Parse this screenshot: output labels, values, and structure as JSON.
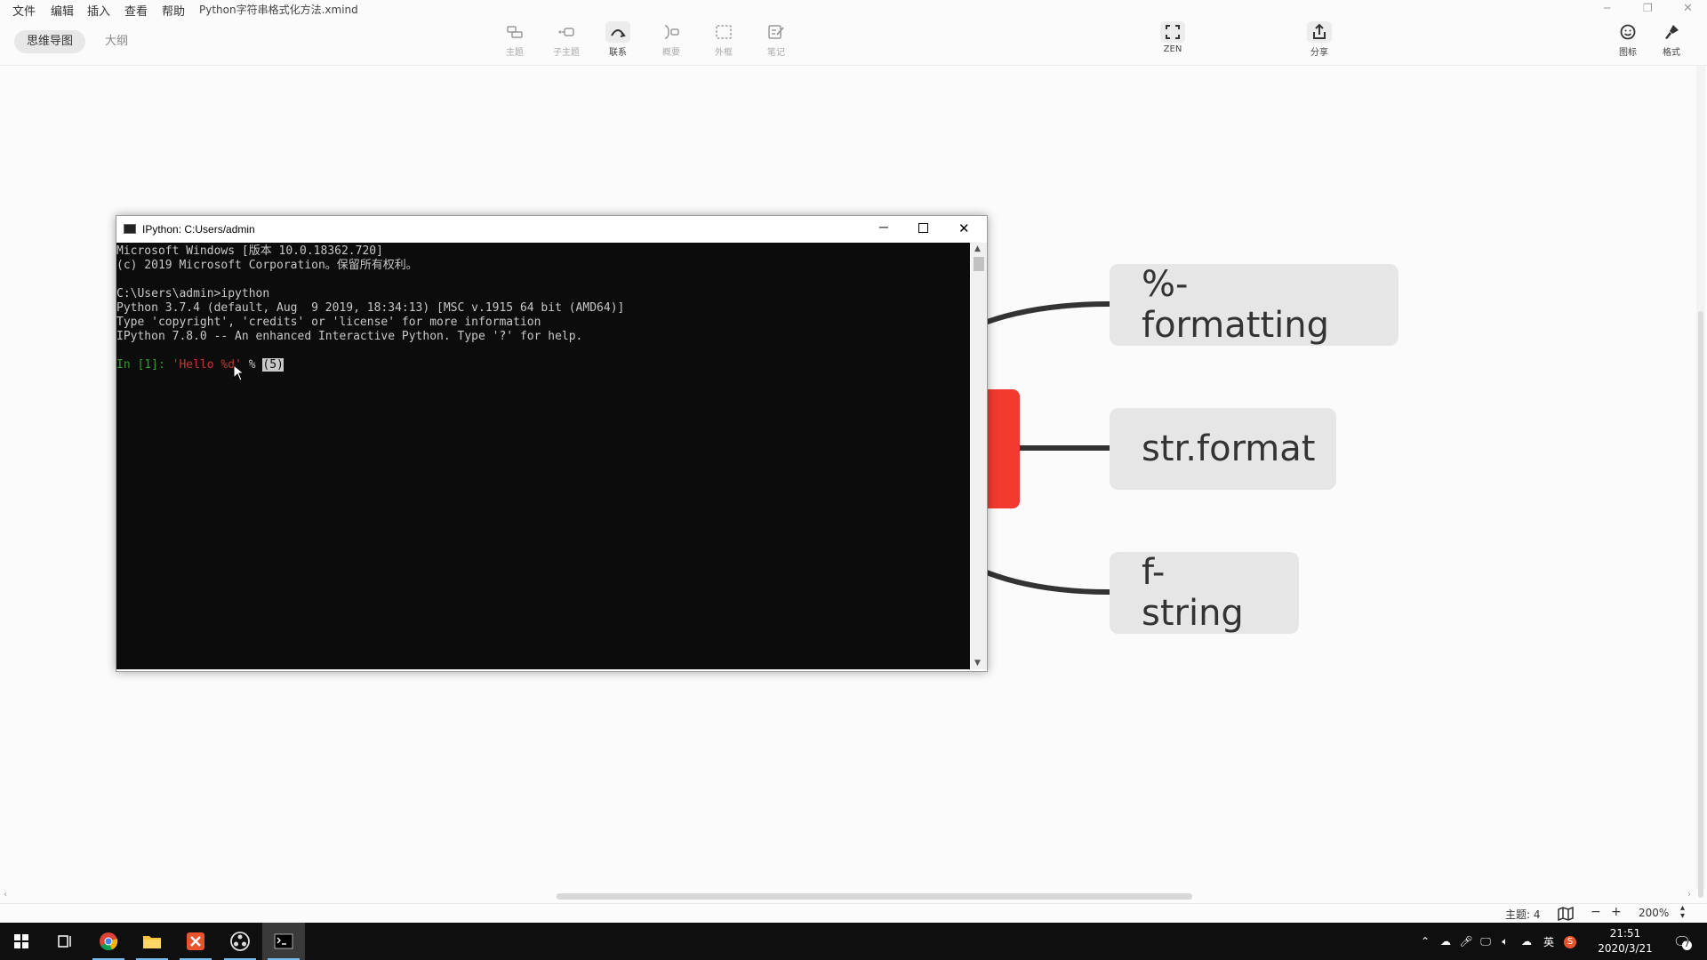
{
  "menubar": {
    "items": [
      "文件",
      "编辑",
      "插入",
      "查看",
      "帮助"
    ],
    "filename": "Python字符串格式化方法.xmind"
  },
  "view_tabs": {
    "mindmap": "思维导图",
    "outline": "大纲"
  },
  "toolbar": {
    "topic": "主题",
    "subtopic": "子主题",
    "relationship": "联系",
    "summary": "概要",
    "boundary": "外框",
    "note": "笔记",
    "zen": "ZEN",
    "share": "分享",
    "icons": "图标",
    "format": "格式"
  },
  "mindmap": {
    "topics": [
      "%-formatting",
      "str.format",
      "f-string"
    ],
    "accent_color": "#f23a2f"
  },
  "console": {
    "title": "IPython: C:Users/admin",
    "lines": [
      "Microsoft Windows [版本 10.0.18362.720]",
      "(c) 2019 Microsoft Corporation。保留所有权利。",
      "",
      "C:\\Users\\admin>ipython",
      "Python 3.7.4 (default, Aug  9 2019, 18:34:13) [MSC v.1915 64 bit (AMD64)]",
      "Type 'copyright', 'credits' or 'license' for more information",
      "IPython 7.8.0 -- An enhanced Interactive Python. Type '?' for help."
    ],
    "prompt": "In [1]: ",
    "input_string": "'Hello %d'",
    "input_rest": " % ",
    "input_cursor": "(5)"
  },
  "status": {
    "topic_count": "主题: 4",
    "zoom_out": "−",
    "zoom_in": "+",
    "zoom": "200%"
  },
  "taskbar": {
    "time": "21:51",
    "date": "2020/3/21",
    "ime": "英",
    "notifications": "7"
  }
}
